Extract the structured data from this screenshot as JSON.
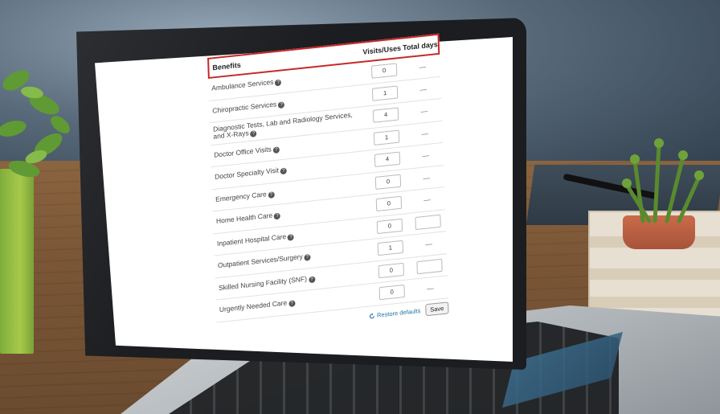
{
  "table": {
    "header": {
      "benefits": "Benefits",
      "visits": "Visits/Uses",
      "days": "Total days"
    },
    "rows": [
      {
        "label": "Ambulance Services",
        "visits": "0",
        "days": "—"
      },
      {
        "label": "Chiropractic Services",
        "visits": "1",
        "days": "—"
      },
      {
        "label": "Diagnostic Tests, Lab and Radiology Services, and X-Rays",
        "visits": "4",
        "days": "—"
      },
      {
        "label": "Doctor Office Visits",
        "visits": "1",
        "days": "—"
      },
      {
        "label": "Doctor Specialty Visit",
        "visits": "4",
        "days": "—"
      },
      {
        "label": "Emergency Care",
        "visits": "0",
        "days": "—"
      },
      {
        "label": "Home Health Care",
        "visits": "0",
        "days": "—"
      },
      {
        "label": "Inpatient Hospital Care",
        "visits": "0",
        "days": ""
      },
      {
        "label": "Outpatient Services/Surgery",
        "visits": "1",
        "days": "—"
      },
      {
        "label": "Skilled Nursing Facility (SNF)",
        "visits": "0",
        "days": ""
      },
      {
        "label": "Urgently Needed Care",
        "visits": "0",
        "days": "—"
      }
    ]
  },
  "footer": {
    "restore_label": "Restore defaults",
    "save_label": "Save"
  },
  "icons": {
    "help": "question-circle-icon",
    "restore": "refresh-icon"
  },
  "colors": {
    "highlight": "#c62828",
    "link": "#1a73a8"
  }
}
